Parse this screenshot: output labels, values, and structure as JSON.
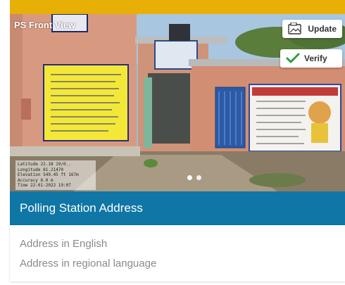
{
  "photo": {
    "label": "PS Front View",
    "stamp_lines": [
      "Latitude 22.18 19/0..",
      "Longitude 81.21470",
      "Elevation 549.45 ft 167m",
      "Accuracy 6.0 m",
      "Time 22-01-2022 19:07"
    ],
    "carousel_total": 2,
    "carousel_active": 1
  },
  "actions": {
    "update_label": "Update",
    "verify_label": "Verify",
    "update_icon": "image-edit-icon",
    "verify_icon": "checkmark-icon",
    "verify_color": "#2e9e3e"
  },
  "section": {
    "title": "Polling Station Address"
  },
  "address": {
    "english_placeholder": "Address in English",
    "regional_placeholder": "Address in regional language"
  },
  "colors": {
    "accent": "#e8b007",
    "header": "#0f76a6"
  }
}
